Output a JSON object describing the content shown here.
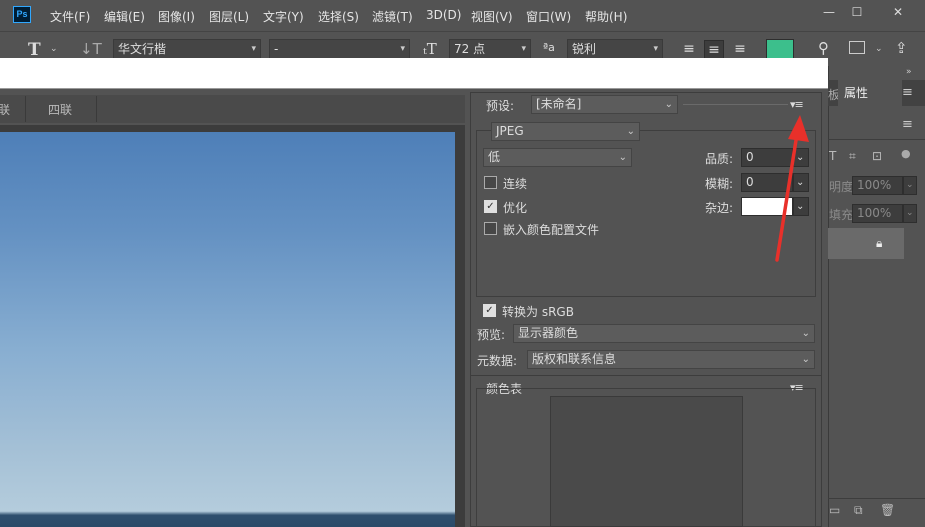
{
  "menubar": {
    "logo": "Ps",
    "items": [
      "文件(F)",
      "编辑(E)",
      "图像(I)",
      "图层(L)",
      "文字(Y)",
      "选择(S)",
      "滤镜(T)",
      "3D(D)",
      "视图(V)",
      "窗口(W)",
      "帮助(H)"
    ],
    "window_controls": [
      "—",
      "☐",
      "✕"
    ]
  },
  "options_bar": {
    "font_family": "华文行楷",
    "font_style": "-",
    "font_size": "72 点",
    "aa_label": "ªa",
    "anti_alias": "锐利",
    "color_swatch": "#3cbf8c"
  },
  "doc_tabs": [
    "联",
    "四联"
  ],
  "settings": {
    "preset_label": "预设:",
    "preset_value": "[未命名]",
    "format": "JPEG",
    "quality_preset": "低",
    "quality_label": "品质:",
    "quality_value": "0",
    "progressive_label": "连续",
    "progressive_checked": false,
    "blur_label": "模糊:",
    "blur_value": "0",
    "optimize_label": "优化",
    "optimize_checked": true,
    "matte_label": "杂边:",
    "embed_profile_label": "嵌入颜色配置文件",
    "embed_profile_checked": false,
    "convert_srgb_label": "转换为 sRGB",
    "convert_srgb_checked": true,
    "preview_label": "预览:",
    "preview_value": "显示器颜色",
    "metadata_label": "元数据:",
    "metadata_value": "版权和联系信息",
    "color_table_label": "颜色表"
  },
  "right_panel": {
    "tab_left_partial": "板",
    "tab_active": "属性",
    "opacity_label": "明度:",
    "opacity_value": "100%",
    "fill_label": "填充:",
    "fill_value": "100%"
  },
  "colors": {
    "accent_arrow": "#e8302a",
    "swatch": "#3cbf8c"
  }
}
